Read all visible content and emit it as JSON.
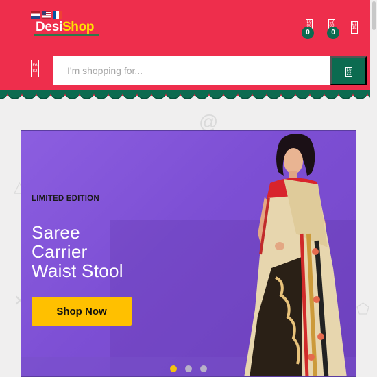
{
  "header": {
    "languages": [
      "Nederlands",
      "English",
      "Français"
    ],
    "logo": {
      "part1": "Desi",
      "part2": "Shop"
    },
    "wishlist": {
      "icon": "heart-icon",
      "count": "0"
    },
    "cart": {
      "icon": "cart-icon",
      "count": "0"
    },
    "account_icon": "user-icon",
    "menu_icon": "menu-icon",
    "search": {
      "placeholder": "I'm shopping for...",
      "button_icon": "search-icon"
    }
  },
  "banner": {
    "kicker": "LIMITED EDITION",
    "headline": [
      "Saree",
      "Carrier",
      "Waist Stool"
    ],
    "cta": "Shop Now",
    "slides": 3,
    "active_slide": 1
  },
  "colors": {
    "header_bg": "#ee2e4c",
    "accent_green": "#0c6b50",
    "logo_yellow": "#ffe200",
    "banner_purple": "#8c5ee0",
    "cta_yellow": "#ffc000"
  }
}
